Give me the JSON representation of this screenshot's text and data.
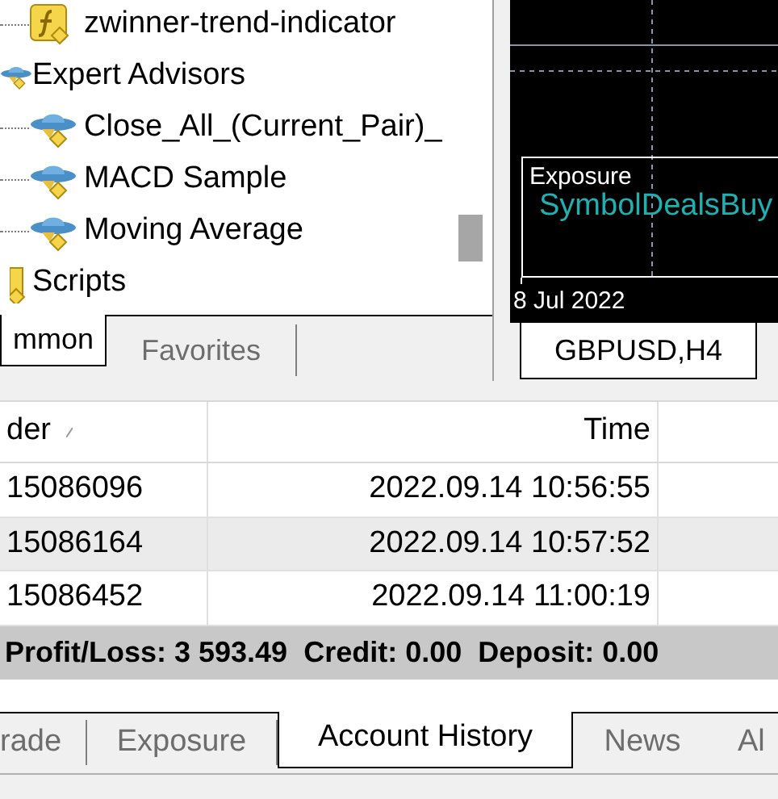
{
  "navigator": {
    "tree": [
      {
        "children": [
          {
            "label": "zwinner-trend-indicator",
            "kind": "indicator"
          }
        ]
      },
      {
        "label": "Expert Advisors",
        "kind": "advisor",
        "children": [
          {
            "label": "Close_All_(Current_Pair)_",
            "kind": "advisor"
          },
          {
            "label": "MACD Sample",
            "kind": "advisor"
          },
          {
            "label": "Moving Average",
            "kind": "advisor"
          }
        ]
      },
      {
        "label": "Scripts",
        "kind": "script"
      }
    ],
    "tabs": [
      {
        "label": "mmon",
        "selected": true
      },
      {
        "label": "Favorites",
        "selected": false
      }
    ]
  },
  "chart": {
    "subwindow_title": "Exposure",
    "subwindow_columns": [
      "Symbol",
      "Deals",
      "Buy"
    ],
    "time_labels": [
      "8 Jul 2022"
    ],
    "tabs": [
      {
        "label": "GBPUSD,H4",
        "selected": true
      }
    ]
  },
  "table": {
    "columns": [
      {
        "label": "der",
        "sorted": true
      },
      {
        "label": "Time",
        "sorted": false
      }
    ],
    "rows": [
      {
        "cells": [
          "15086096",
          "2022.09.14 10:56:55"
        ],
        "selected": false
      },
      {
        "cells": [
          "15086164",
          "2022.09.14 10:57:52"
        ],
        "selected": true
      },
      {
        "cells": [
          "15086452",
          "2022.09.14 11:00:19"
        ],
        "selected": false
      }
    ],
    "summary": "Profit/Loss: 3 593.49  Credit: 0.00  Deposit: 0.00"
  },
  "bottom_tabs": [
    {
      "label": "rade",
      "selected": false
    },
    {
      "label": "Exposure",
      "selected": false
    },
    {
      "label": "Account History",
      "selected": true
    },
    {
      "label": "News",
      "selected": false
    },
    {
      "label": "Al",
      "selected": false
    }
  ]
}
